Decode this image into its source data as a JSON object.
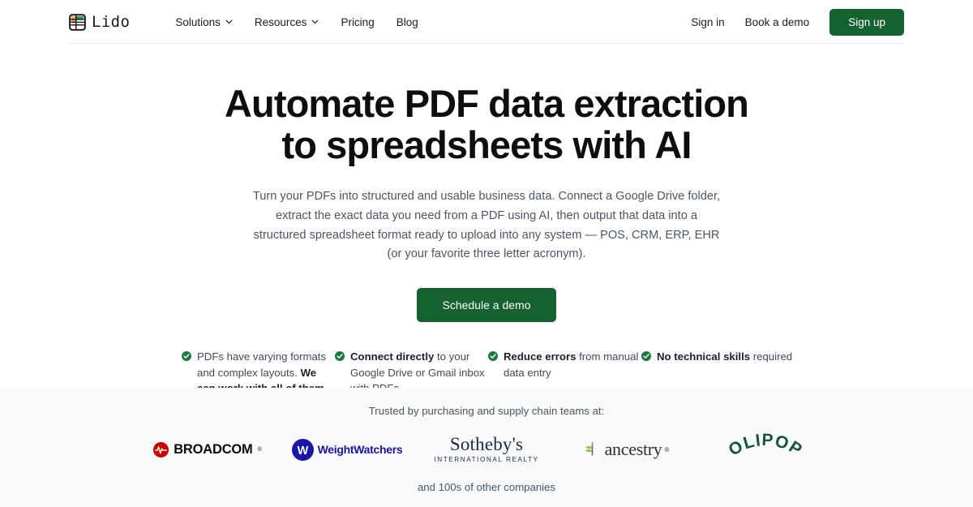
{
  "brand": {
    "name": "Lido",
    "logo_icon": "lido-grid-logo"
  },
  "nav": {
    "links": [
      {
        "label": "Solutions",
        "has_caret": true
      },
      {
        "label": "Resources",
        "has_caret": true
      },
      {
        "label": "Pricing",
        "has_caret": false
      },
      {
        "label": "Blog",
        "has_caret": false
      }
    ],
    "signin_label": "Sign in",
    "bookdemo_label": "Book a demo",
    "signup_label": "Sign up",
    "signup_color": "#136230"
  },
  "hero": {
    "heading_line1": "Automate PDF data extraction",
    "heading_line2": "to spreadsheets with AI",
    "subtitle": "Turn your PDFs into structured and usable business data. Connect a Google Drive folder, extract the exact data you need from a PDF using AI, then output that data into a structured spreadsheet format ready to upload into any system — POS, CRM, ERP, EHR (or your favorite three letter acronym).",
    "cta_label": "Schedule a demo",
    "cta_color": "#136230"
  },
  "features": [
    {
      "icon": "check-circle-icon",
      "text_plain": "PDFs have varying formats and complex layouts. ",
      "text_bold": "We can work with all of them.",
      "text_tail": ""
    },
    {
      "icon": "check-circle-icon",
      "text_plain": "",
      "text_bold": "Connect directly",
      "text_tail": " to your Google Drive or Gmail inbox with PDFs"
    },
    {
      "icon": "check-circle-icon",
      "text_plain": "",
      "text_bold": "Reduce errors",
      "text_tail": " from manual data entry"
    },
    {
      "icon": "check-circle-icon",
      "text_plain": "",
      "text_bold": "No technical skills",
      "text_tail": " required"
    }
  ],
  "trust": {
    "title": "Trusted by purchasing and supply chain teams at:",
    "footer": "and 100s of other companies",
    "background": "#f8f9fb",
    "logos": [
      {
        "name": "Broadcom",
        "word": "BROADCOM",
        "tm": "®",
        "color": "#0b0b0b",
        "mark_color": "#cc0000"
      },
      {
        "name": "WeightWatchers",
        "word": "WeightWatchers",
        "color": "#1a16a8",
        "mark_letter": "W"
      },
      {
        "name": "Sotheby's International Realty",
        "word": "Sotheby's",
        "subword": "INTERNATIONAL REALTY",
        "color": "#1e2a45"
      },
      {
        "name": "Ancestry",
        "word": "ancestry",
        "tm": "®",
        "color": "#2f2f2f",
        "mark_color": "#8cc63f"
      },
      {
        "name": "OLIPOP",
        "word": "OLIPOP",
        "color": "#14533c"
      }
    ]
  }
}
